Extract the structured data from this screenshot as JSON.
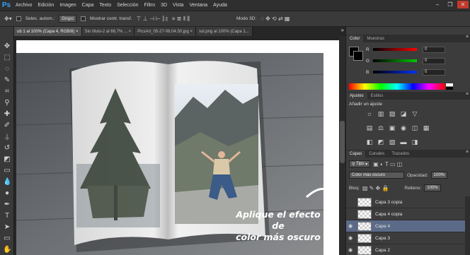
{
  "app": {
    "logo": "Ps"
  },
  "menu": [
    "Archivo",
    "Edición",
    "Imagen",
    "Capa",
    "Texto",
    "Selección",
    "Filtro",
    "3D",
    "Vista",
    "Ventana",
    "Ayuda"
  ],
  "window_controls": {
    "minimize": "–",
    "restore": "❐",
    "close": "✕"
  },
  "options": {
    "auto_select_label": "Selec. autom.:",
    "auto_select_value": "Grupo",
    "show_transform_label": "Mostrar contr. transf.",
    "mode3d_label": "Modo 3D:"
  },
  "doc_tabs": [
    {
      "label": "ub 1 al 100% (Capa 4, RGB/8) ×",
      "active": true
    },
    {
      "label": "Sin título-2 al 66,7% ... ×",
      "active": false
    },
    {
      "label": "PicsArt_05-27-06.04.50.jpg ×",
      "active": false
    },
    {
      "label": "sol.png al 100% (Capa 1...",
      "active": false
    }
  ],
  "tab_overflow": "»",
  "annotation": {
    "line1": "Aplique el efecto de",
    "line2": "color más oscuro"
  },
  "color_panel": {
    "tabs": [
      "Color",
      "Muestras"
    ],
    "channels": [
      {
        "letter": "R",
        "value": "0",
        "color": "#d11c1c"
      },
      {
        "letter": "G",
        "value": "0",
        "color": "#1ca81c"
      },
      {
        "letter": "B",
        "value": "0",
        "color": "#1c3ad1"
      }
    ]
  },
  "adjustments_panel": {
    "tabs": [
      "Ajustes",
      "Estilos"
    ],
    "title": "Añadir un ajuste",
    "row1": [
      "☼",
      "▥",
      "▨",
      "◪",
      "▽"
    ],
    "row2": [
      "▤",
      "⚖",
      "▣",
      "◉",
      "◫",
      "▦"
    ],
    "row3": [
      "◧",
      "◩",
      "▧",
      "▬",
      "◨"
    ]
  },
  "layers_panel": {
    "tabs": [
      "Capas",
      "Canales",
      "Trazados"
    ],
    "filter_label": "Tipo",
    "blend_mode": "Color más oscuro",
    "opacity_label": "Opacidad:",
    "opacity_value": "100%",
    "lock_label": "Bloq:",
    "fill_label": "Relleno:",
    "fill_value": "100%",
    "layers": [
      {
        "name": "Capa 3 copia",
        "selected": false
      },
      {
        "name": "Capa 4 copia",
        "selected": false
      },
      {
        "name": "Capa 4",
        "selected": true
      },
      {
        "name": "Capa 3",
        "selected": false
      },
      {
        "name": "Capa 2",
        "selected": false
      }
    ]
  }
}
